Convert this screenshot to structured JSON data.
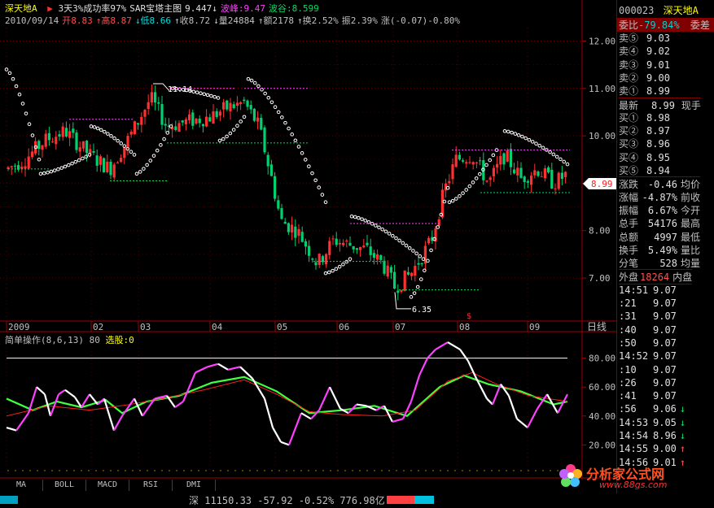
{
  "header": {
    "stock_name": "深天地A",
    "line1_items": [
      {
        "text": "3天3%成功率97%",
        "color": "#e0e0e0"
      },
      {
        "text": "SAR宝塔主图",
        "color": "#e0e0e0"
      },
      {
        "text": "9.447↓",
        "color": "#e0e0e0"
      },
      {
        "text": "波峰:9.47",
        "color": "#ff40ff"
      },
      {
        "text": "波谷:8.599",
        "color": "#00e060"
      }
    ],
    "line2_items": [
      {
        "text": "2010/09/14",
        "color": "#c0c0c0"
      },
      {
        "text": "开8.83",
        "color": "#ff5050"
      },
      {
        "text": "↑高8.87",
        "color": "#ff5050"
      },
      {
        "text": "↓低8.66",
        "color": "#00e0e0"
      },
      {
        "text": "↑收8.72",
        "color": "#c0c0c0"
      },
      {
        "text": "↓量24884",
        "color": "#c0c0c0"
      },
      {
        "text": "↑额2178",
        "color": "#c0c0c0"
      },
      {
        "text": "↑换2.52%",
        "color": "#c0c0c0"
      },
      {
        "text": "振2.39%",
        "color": "#c0c0c0"
      },
      {
        "text": "涨(-0.07)-0.80%",
        "color": "#c0c0c0"
      }
    ]
  },
  "main_chart": {
    "y_ticks": [
      "12.00",
      "11.00",
      "10.00",
      "9.00",
      "8.00",
      "7.00"
    ],
    "current_price_tag": "8.99",
    "high_annotation": "11.14",
    "low_annotation": "6.35",
    "x_labels": [
      "2009",
      "02",
      "03",
      "04",
      "05",
      "06",
      "07",
      "08",
      "09"
    ],
    "period_label": "日线",
    "colors": {
      "up": "#ff3030",
      "down": "#00d070",
      "sar": "#ffffff",
      "peak": "#ff40ff",
      "trough": "#00e060"
    }
  },
  "indicator": {
    "title": "简单操作(8,6,13) 80",
    "signal_label": "选股:0",
    "y_ticks": [
      "80.00",
      "60.00",
      "40.00",
      "20.00"
    ],
    "colors": {
      "fast_up": "#ff40ff",
      "fast_down": "#ffffff",
      "slow": "#40ff40",
      "mid": "#ff2020",
      "ref": "#ffffff"
    }
  },
  "tabs": [
    "MA",
    "BOLL",
    "MACD",
    "RSI",
    "DMI"
  ],
  "status_bar": {
    "text": "深 11150.33 -57.92 -0.52% 776.98亿"
  },
  "right_panel": {
    "code": "000023",
    "name": "深天地A",
    "weibi_label": "委比",
    "weibi_value": "-79.84%",
    "weicha_label": "委差",
    "asks": [
      {
        "label": "卖⑤",
        "price": "9.03"
      },
      {
        "label": "卖④",
        "price": "9.02"
      },
      {
        "label": "卖③",
        "price": "9.01"
      },
      {
        "label": "卖②",
        "price": "9.00"
      },
      {
        "label": "卖①",
        "price": "8.99"
      }
    ],
    "last_label": "最新",
    "last_value": "8.99",
    "last_side": "现手",
    "bids": [
      {
        "label": "买①",
        "price": "8.98"
      },
      {
        "label": "买②",
        "price": "8.97"
      },
      {
        "label": "买③",
        "price": "8.96"
      },
      {
        "label": "买④",
        "price": "8.95"
      },
      {
        "label": "买⑤",
        "price": "8.94"
      }
    ],
    "stats": [
      {
        "label": "涨跌",
        "value": "-0.46",
        "side": "均价"
      },
      {
        "label": "涨幅",
        "value": "-4.87%",
        "side": "前收"
      },
      {
        "label": "振幅",
        "value": "6.67%",
        "side": "今开"
      },
      {
        "label": "总手",
        "value": "54176",
        "side": "最高"
      },
      {
        "label": "总额",
        "value": "4997",
        "side": "最低"
      },
      {
        "label": "换手",
        "value": "5.49%",
        "side": "量比"
      },
      {
        "label": "分笔",
        "value": "528",
        "side": "均量"
      }
    ],
    "outer_label": "外盘",
    "outer_value": "18264",
    "inner_label": "内盘",
    "ticks": [
      {
        "time": "14:51",
        "price": "9.07",
        "vol": "",
        "arrow": ""
      },
      {
        "time": ":21",
        "price": "9.07",
        "vol": "",
        "arrow": ""
      },
      {
        "time": ":31",
        "price": "9.07",
        "vol": "",
        "arrow": ""
      },
      {
        "time": ":40",
        "price": "9.07",
        "vol": "",
        "arrow": ""
      },
      {
        "time": ":50",
        "price": "9.07",
        "vol": "",
        "arrow": ""
      },
      {
        "time": "14:52",
        "price": "9.07",
        "vol": "",
        "arrow": ""
      },
      {
        "time": ":10",
        "price": "9.07",
        "vol": "",
        "arrow": ""
      },
      {
        "time": ":26",
        "price": "9.07",
        "vol": "",
        "arrow": ""
      },
      {
        "time": ":41",
        "price": "9.07",
        "vol": "",
        "arrow": ""
      },
      {
        "time": ":56",
        "price": "9.06",
        "vol": "",
        "arrow": "↓"
      },
      {
        "time": "14:53",
        "price": "9.05",
        "vol": "",
        "arrow": "↓"
      },
      {
        "time": "14:54",
        "price": "8.96",
        "vol": "",
        "arrow": "↓"
      },
      {
        "time": "14:55",
        "price": "9.00",
        "vol": "",
        "arrow": "↑"
      },
      {
        "time": "14:56",
        "price": "9.01",
        "vol": "",
        "arrow": "↑"
      }
    ]
  },
  "watermark": {
    "title": "分析家公式网",
    "url": "www.88gs.com"
  }
}
